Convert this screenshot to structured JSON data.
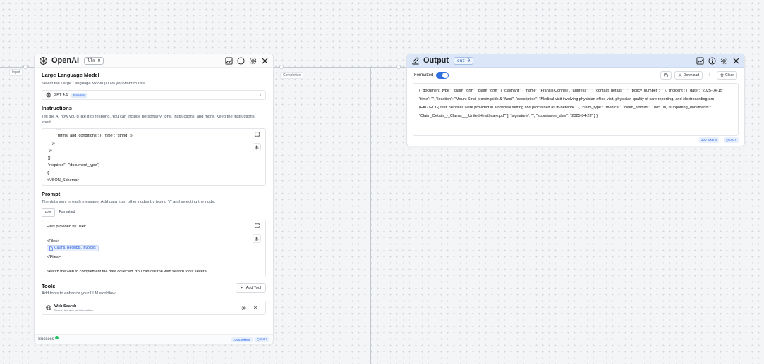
{
  "canvas": {
    "left_port_label": "Input",
    "mid_port_label": "Completion"
  },
  "llm_node": {
    "title": "OpenAI",
    "node_id": "llm-0",
    "model_section": {
      "title": "Large Language Model",
      "description": "Select the Large Language Model (LLM) you want to use.",
      "model_name": "GPT 4.1",
      "model_badge": "Smartest"
    },
    "instructions": {
      "title": "Instructions",
      "description": "Tell the AI how you'd like it to respond. You can include personality, tone, instructions, and more. Keep the instructions short.",
      "lines": [
        "\"\"\"",
        "\"terms_and_conditions\": {{ \"type\": \"string\" }}",
        "}}",
        "}}",
        "}},",
        "\"required\": [\"document_type\"]",
        "}}",
        "</JSON_Schema>"
      ]
    },
    "prompt": {
      "title": "Prompt",
      "description": "The data sent in each message. Add data from other nodes by typing \"/\" and selecting the node.",
      "tabs": [
        "Edit",
        "Formatted"
      ],
      "line1": "Files provided by user:",
      "line2": "<Files>",
      "file_chip": "Claims, Receipts, Invoices",
      "line3": "</Files>",
      "line4": "Search the web to complement the data collected. You can call the web search tools several"
    },
    "tools": {
      "title": "Tools",
      "description": "Add tools to enhance your LLM workflow.",
      "add_label": "Add Tool",
      "items": [
        {
          "name": "Web Search",
          "description": "Search the web for information."
        }
      ]
    },
    "footer": {
      "status": "Success",
      "tokens": "2365 tokens",
      "time": "3.0 s",
      "status_color": "#22c55e"
    }
  },
  "output_node": {
    "title": "Output",
    "node_id": "out-0",
    "formatted_label": "Formatted",
    "formatted_on": true,
    "download_label": "Download",
    "clear_label": "Clear",
    "text": "{ \"document_type\": \"claim_form\", \"claim_form\": { \"claimant\": { \"name\": \"Francis Connell\", \"address\": \"\", \"contact_details\": \"\", \"policy_number\": \"\" }, \"incident\": { \"date\": \"2025-04-15\", \"time\": \"\", \"location\": \"Mount Sinai Morningside & West\", \"description\": \"Medical visit involving physician office visit, physician quality of care reporting, and electrocardiogram (EKG/ECG) test. Services were provided in a hospital setting and processed as in-network.\" }, \"claim_type\": \"medical\", \"claim_amount\": 1085.00, \"supporting_documents\": [ \"Claim_Details_-_Claims___UnitedHealthcare.pdf\" ], \"signature\": \"\", \"submission_date\": \"2025-04-23\" } }",
    "tokens": "200 tokens",
    "time": "0.0 s"
  },
  "colors": {
    "accent": "#2f6fe0",
    "output_header": "#dbe7f8"
  }
}
